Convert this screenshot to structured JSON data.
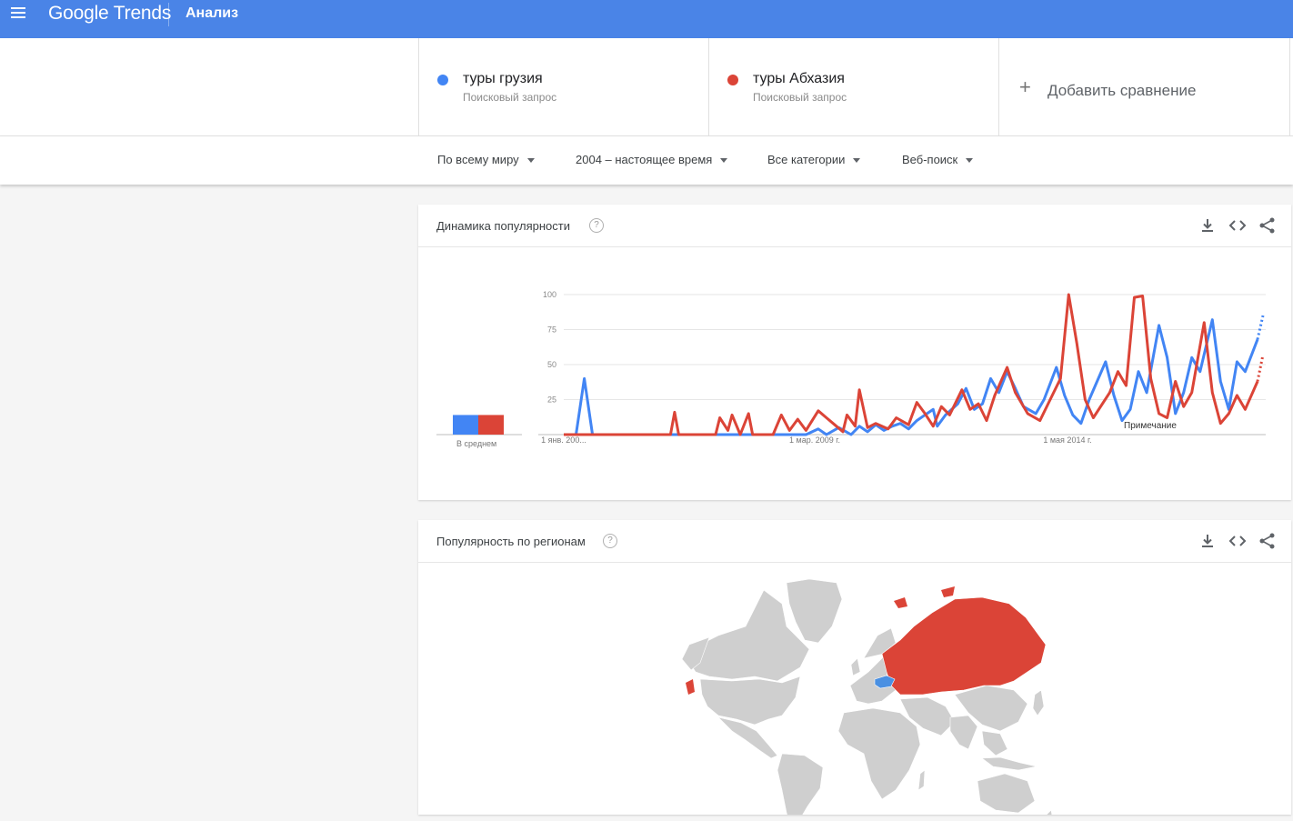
{
  "header": {
    "logo_google": "Google",
    "logo_trends": "Trends",
    "page_title": "Анализ"
  },
  "compare": {
    "terms": [
      {
        "name": "туры грузия",
        "type": "Поисковый запрос",
        "color": "#4285f4"
      },
      {
        "name": "туры Абхазия",
        "type": "Поисковый запрос",
        "color": "#db4437"
      }
    ],
    "add_label": "Добавить сравнение"
  },
  "filters": {
    "region": "По всему миру",
    "time": "2004 – настоящее время",
    "category": "Все категории",
    "search_type": "Веб-поиск"
  },
  "interest_card": {
    "title": "Динамика популярности",
    "avg_label": "В среднем",
    "note_label": "Примечание"
  },
  "region_card": {
    "title": "Популярность по регионам"
  },
  "icons": {
    "menu": "menu-icon",
    "help": "help-icon",
    "download": "download-icon",
    "embed": "embed-icon",
    "share": "share-icon",
    "plus": "plus-icon"
  },
  "chart_data": {
    "type": "line",
    "title": "",
    "ylim": [
      0,
      100
    ],
    "yticks": [
      25,
      50,
      75,
      100
    ],
    "xtick_labels": [
      "1 янв. 200...",
      "1 мар. 2009 г.",
      "1 мая 2014 г."
    ],
    "x_start": "2004-01",
    "x_end": "2018-04",
    "grid": true,
    "averages": [
      {
        "name": "туры грузия",
        "value": 14
      },
      {
        "name": "туры Абхазия",
        "value": 14
      }
    ],
    "series": [
      {
        "name": "туры грузия",
        "color": "#4285f4",
        "points": [
          [
            "2004-01",
            0
          ],
          [
            "2004-04",
            0
          ],
          [
            "2004-06",
            40
          ],
          [
            "2004-08",
            0
          ],
          [
            "2008-12",
            0
          ],
          [
            "2009-03",
            4
          ],
          [
            "2009-05",
            0
          ],
          [
            "2009-08",
            5
          ],
          [
            "2009-11",
            0
          ],
          [
            "2010-01",
            6
          ],
          [
            "2010-03",
            2
          ],
          [
            "2010-05",
            7
          ],
          [
            "2010-07",
            3
          ],
          [
            "2010-09",
            6
          ],
          [
            "2010-11",
            8
          ],
          [
            "2011-01",
            4
          ],
          [
            "2011-03",
            10
          ],
          [
            "2011-05",
            14
          ],
          [
            "2011-07",
            18
          ],
          [
            "2011-08",
            6
          ],
          [
            "2011-10",
            14
          ],
          [
            "2012-01",
            22
          ],
          [
            "2012-03",
            33
          ],
          [
            "2012-05",
            18
          ],
          [
            "2012-07",
            22
          ],
          [
            "2012-09",
            40
          ],
          [
            "2012-11",
            30
          ],
          [
            "2013-01",
            45
          ],
          [
            "2013-03",
            33
          ],
          [
            "2013-05",
            20
          ],
          [
            "2013-08",
            15
          ],
          [
            "2013-10",
            25
          ],
          [
            "2014-01",
            48
          ],
          [
            "2014-03",
            28
          ],
          [
            "2014-05",
            14
          ],
          [
            "2014-07",
            8
          ],
          [
            "2014-09",
            25
          ],
          [
            "2015-01",
            52
          ],
          [
            "2015-03",
            28
          ],
          [
            "2015-05",
            10
          ],
          [
            "2015-07",
            18
          ],
          [
            "2015-09",
            45
          ],
          [
            "2015-11",
            30
          ],
          [
            "2016-02",
            78
          ],
          [
            "2016-04",
            55
          ],
          [
            "2016-06",
            15
          ],
          [
            "2016-08",
            30
          ],
          [
            "2016-10",
            55
          ],
          [
            "2016-12",
            45
          ],
          [
            "2017-03",
            82
          ],
          [
            "2017-05",
            38
          ],
          [
            "2017-07",
            18
          ],
          [
            "2017-09",
            52
          ],
          [
            "2017-11",
            45
          ],
          [
            "2018-02",
            68
          ]
        ],
        "partial_end": 85
      },
      {
        "name": "туры Абхазия",
        "color": "#db4437",
        "points": [
          [
            "2004-01",
            0
          ],
          [
            "2006-03",
            0
          ],
          [
            "2006-04",
            16
          ],
          [
            "2006-05",
            0
          ],
          [
            "2007-02",
            0
          ],
          [
            "2007-03",
            12
          ],
          [
            "2007-05",
            3
          ],
          [
            "2007-06",
            14
          ],
          [
            "2007-08",
            0
          ],
          [
            "2007-10",
            15
          ],
          [
            "2007-11",
            0
          ],
          [
            "2008-04",
            0
          ],
          [
            "2008-06",
            14
          ],
          [
            "2008-08",
            3
          ],
          [
            "2008-10",
            11
          ],
          [
            "2008-12",
            3
          ],
          [
            "2009-03",
            17
          ],
          [
            "2009-05",
            12
          ],
          [
            "2009-07",
            7
          ],
          [
            "2009-09",
            2
          ],
          [
            "2009-10",
            14
          ],
          [
            "2009-12",
            6
          ],
          [
            "2010-01",
            32
          ],
          [
            "2010-03",
            5
          ],
          [
            "2010-05",
            8
          ],
          [
            "2010-08",
            4
          ],
          [
            "2010-10",
            12
          ],
          [
            "2011-01",
            7
          ],
          [
            "2011-03",
            23
          ],
          [
            "2011-05",
            15
          ],
          [
            "2011-07",
            6
          ],
          [
            "2011-09",
            20
          ],
          [
            "2011-11",
            14
          ],
          [
            "2012-02",
            32
          ],
          [
            "2012-04",
            18
          ],
          [
            "2012-06",
            22
          ],
          [
            "2012-08",
            10
          ],
          [
            "2012-10",
            28
          ],
          [
            "2013-01",
            48
          ],
          [
            "2013-03",
            30
          ],
          [
            "2013-06",
            15
          ],
          [
            "2013-09",
            10
          ],
          [
            "2013-11",
            22
          ],
          [
            "2014-02",
            40
          ],
          [
            "2014-04",
            100
          ],
          [
            "2014-06",
            65
          ],
          [
            "2014-08",
            25
          ],
          [
            "2014-10",
            12
          ],
          [
            "2015-02",
            30
          ],
          [
            "2015-04",
            45
          ],
          [
            "2015-06",
            35
          ],
          [
            "2015-08",
            98
          ],
          [
            "2015-10",
            99
          ],
          [
            "2015-12",
            40
          ],
          [
            "2016-02",
            15
          ],
          [
            "2016-04",
            12
          ],
          [
            "2016-06",
            38
          ],
          [
            "2016-08",
            20
          ],
          [
            "2016-10",
            30
          ],
          [
            "2017-01",
            80
          ],
          [
            "2017-03",
            30
          ],
          [
            "2017-05",
            8
          ],
          [
            "2017-07",
            15
          ],
          [
            "2017-09",
            28
          ],
          [
            "2017-11",
            18
          ],
          [
            "2018-02",
            38
          ]
        ],
        "partial_end": 57
      }
    ]
  }
}
